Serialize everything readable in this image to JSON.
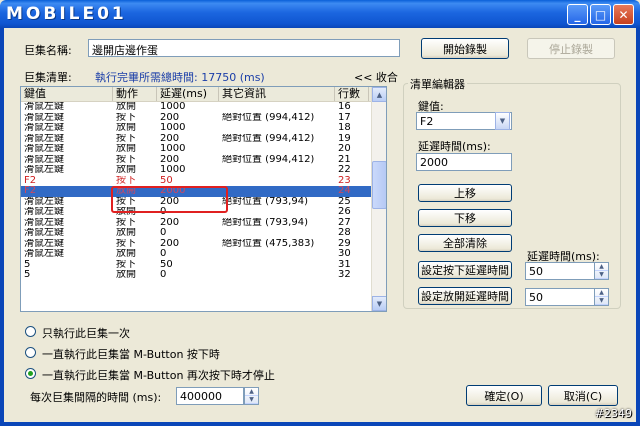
{
  "window": {
    "logo_text": "MOBILE01",
    "minimize": "_",
    "maximize": "□",
    "close": "✕"
  },
  "macro": {
    "name_label": "巨集名稱:",
    "name_value": "邊開店邊作蛋",
    "list_label": "巨集清單:",
    "total_time_label": "執行完畢所需總時間: 17750 (ms)",
    "collapse_label": "<< 收合",
    "start_record": "開始錄製",
    "stop_record": "停止錄製"
  },
  "table": {
    "columns": [
      "鍵值",
      "動作",
      "延遲(ms)",
      "其它資訊",
      "行數"
    ],
    "rows": [
      {
        "key": "滑鼠左鍵",
        "action": "放開",
        "delay": "1000",
        "info": "",
        "line": "16"
      },
      {
        "key": "滑鼠左鍵",
        "action": "按下",
        "delay": "200",
        "info": "絕對位置 (994,412)",
        "line": "17"
      },
      {
        "key": "滑鼠左鍵",
        "action": "放開",
        "delay": "1000",
        "info": "",
        "line": "18"
      },
      {
        "key": "滑鼠左鍵",
        "action": "按下",
        "delay": "200",
        "info": "絕對位置 (994,412)",
        "line": "19"
      },
      {
        "key": "滑鼠左鍵",
        "action": "放開",
        "delay": "1000",
        "info": "",
        "line": "20"
      },
      {
        "key": "滑鼠左鍵",
        "action": "按下",
        "delay": "200",
        "info": "絕對位置 (994,412)",
        "line": "21"
      },
      {
        "key": "滑鼠左鍵",
        "action": "放開",
        "delay": "1000",
        "info": "",
        "line": "22"
      },
      {
        "key": "F2",
        "action": "按下",
        "delay": "50",
        "info": "",
        "line": "23"
      },
      {
        "key": "F2",
        "action": "放開",
        "delay": "2000",
        "info": "",
        "line": "24"
      },
      {
        "key": "滑鼠左鍵",
        "action": "按下",
        "delay": "200",
        "info": "絕對位置 (793,94)",
        "line": "25"
      },
      {
        "key": "滑鼠左鍵",
        "action": "放開",
        "delay": "0",
        "info": "",
        "line": "26"
      },
      {
        "key": "滑鼠左鍵",
        "action": "按下",
        "delay": "200",
        "info": "絕對位置 (793,94)",
        "line": "27"
      },
      {
        "key": "滑鼠左鍵",
        "action": "放開",
        "delay": "0",
        "info": "",
        "line": "28"
      },
      {
        "key": "滑鼠左鍵",
        "action": "按下",
        "delay": "200",
        "info": "絕對位置 (475,383)",
        "line": "29"
      },
      {
        "key": "滑鼠左鍵",
        "action": "放開",
        "delay": "0",
        "info": "",
        "line": "30"
      },
      {
        "key": "5",
        "action": "按下",
        "delay": "50",
        "info": "",
        "line": "31"
      },
      {
        "key": "5",
        "action": "放開",
        "delay": "0",
        "info": "",
        "line": "32"
      }
    ],
    "scroll_up": "▲",
    "scroll_down": "▼"
  },
  "editor": {
    "group_title": "清單編輯器",
    "key_label": "鍵值:",
    "key_value": "F2",
    "delay_label": "延遲時間(ms):",
    "delay_value": "2000",
    "move_up": "上移",
    "move_down": "下移",
    "clear_all": "全部清除",
    "set_press_delay": "設定按下延遲時間",
    "set_release_delay": "設定放開延遲時間",
    "delay_time_label": "延遲時間(ms):",
    "press_delay_value": "50",
    "release_delay_value": "50",
    "dropdown_arrow": "▼"
  },
  "run_mode": {
    "options": [
      {
        "label": "只執行此巨集一次",
        "selected": false
      },
      {
        "label": "一直執行此巨集當 M-Button 按下時",
        "selected": false
      },
      {
        "label": "一直執行此巨集當 M-Button 再次按下時才停止",
        "selected": true
      }
    ],
    "interval_label": "每次巨集間隔的時間 (ms):",
    "interval_value": "400000"
  },
  "footer": {
    "ok": "確定(O)",
    "cancel": "取消(C)",
    "stamp": "#2349"
  },
  "colors": {
    "titlebar": "#0a5fd8",
    "selection": "#316ac5",
    "highlight_box": "#e02020",
    "total_time_text": "#1b3ea8"
  }
}
